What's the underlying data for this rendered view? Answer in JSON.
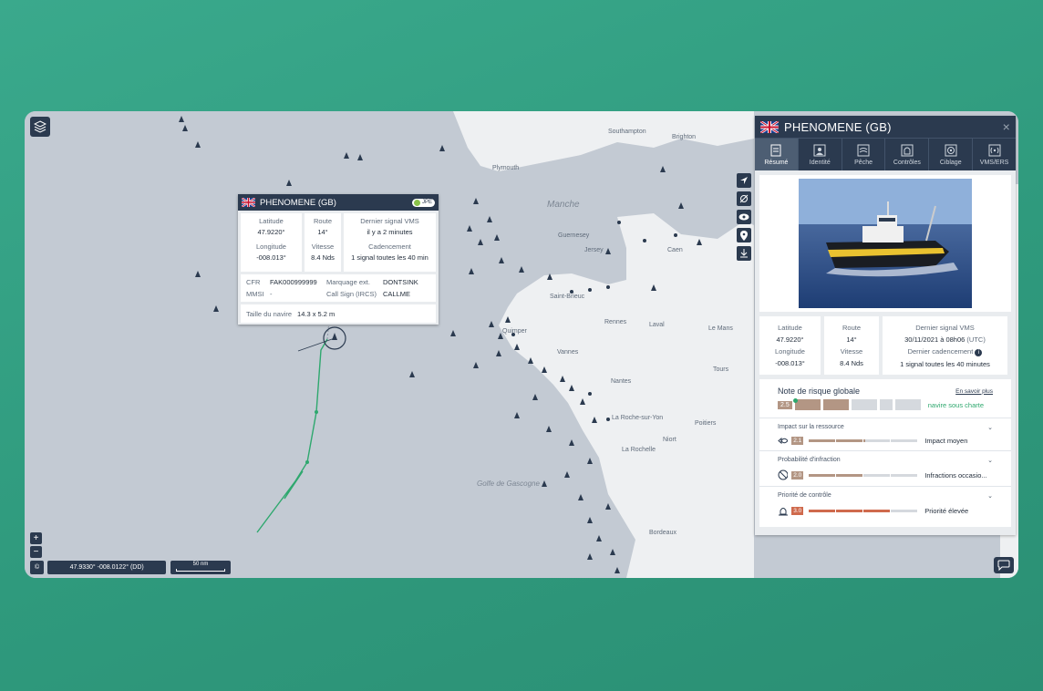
{
  "map": {
    "place_labels": [
      "Southampton",
      "Brighton",
      "Plymouth",
      "Manche",
      "Guernesey",
      "Jersey",
      "Caen",
      "Saint-Brieuc",
      "Rennes",
      "Laval",
      "Le Mans",
      "Quimper",
      "Vannes",
      "Tours",
      "Nantes",
      "La Roche-sur-Yon",
      "Poitiers",
      "Niort",
      "La Rochelle",
      "Golfe de Gascogne",
      "Bordeaux"
    ],
    "coord_readout": "47.9330° -008.0122° (DD)",
    "scale_label": "50 nm",
    "zoom_in": "+",
    "zoom_out": "−",
    "copyright": "©"
  },
  "popup": {
    "vessel": "PHENOMENE (GB)",
    "badge": "JPE",
    "latitude_label": "Latitude",
    "latitude": "47.9220°",
    "longitude_label": "Longitude",
    "longitude": "-008.013°",
    "route_label": "Route",
    "route": "14°",
    "speed_label": "Vitesse",
    "speed": "8.4 Nds",
    "last_signal_label": "Dernier signal VMS",
    "last_signal": "il y a 2 minutes",
    "cadence_label": "Cadencement",
    "cadence": "1 signal toutes les 40 min",
    "cfr_label": "CFR",
    "cfr": "FAK000999999",
    "mmsi_label": "MMSI",
    "mmsi": "-",
    "ext_mark_label": "Marquage ext.",
    "ext_mark": "DONTSINK",
    "callsign_label": "Call Sign (IRCS)",
    "callsign": "CALLME",
    "size_label": "Taille du navire",
    "size": "14.3 x 5.2 m"
  },
  "panel": {
    "title": "PHENOMENE (GB)",
    "close": "×",
    "tabs": [
      {
        "label": "Résumé",
        "icon": "summary-icon"
      },
      {
        "label": "Identité",
        "icon": "identity-icon"
      },
      {
        "label": "Pêche",
        "icon": "fishing-icon"
      },
      {
        "label": "Contrôles",
        "icon": "controls-icon"
      },
      {
        "label": "Ciblage",
        "icon": "target-icon"
      },
      {
        "label": "VMS/ERS",
        "icon": "vms-icon"
      }
    ],
    "latitude_label": "Latitude",
    "latitude": "47.9220°",
    "longitude_label": "Longitude",
    "longitude": "-008.013°",
    "route_label": "Route",
    "route": "14°",
    "speed_label": "Vitesse",
    "speed": "8.4 Nds",
    "last_signal_label": "Dernier signal VMS",
    "last_signal": "30/11/2021 à 08h06",
    "last_signal_tz": "(UTC)",
    "cadence_label": "Dernier cadencement",
    "cadence": "1 signal toutes les 40 minutes",
    "risk": {
      "title": "Note de risque globale",
      "more": "En savoir plus",
      "score": "2.5",
      "score_fraction": 0.5,
      "status": "navire sous charte",
      "items": [
        {
          "title": "Impact sur la ressource",
          "score": "2.1",
          "label": "Impact moyen",
          "color": "#b39684"
        },
        {
          "title": "Probabilité d'infraction",
          "score": "2.0",
          "label": "Infractions occasio...",
          "color": "#b39684"
        },
        {
          "title": "Priorité de contrôle",
          "score": "3.0",
          "label": "Priorité élevée",
          "color": "#cf6a4d"
        }
      ]
    }
  },
  "colors": {
    "navy": "#2b3a4f",
    "track": "#2ea86e",
    "risk_mid": "#b39684",
    "risk_high": "#cf6a4d"
  }
}
